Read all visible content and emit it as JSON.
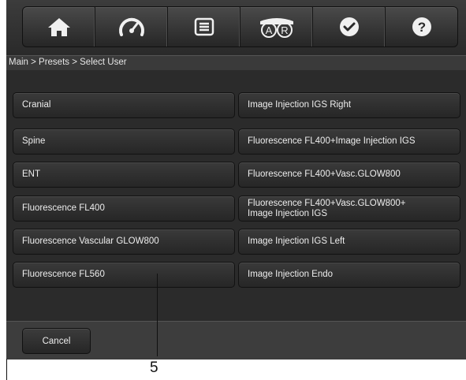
{
  "toolbar": {
    "icons": [
      "home-icon",
      "speedometer-icon",
      "menu-list-icon",
      "ar-eyepiece-icon",
      "checkmark-icon",
      "help-icon"
    ],
    "ar_labels": [
      "A",
      "R"
    ]
  },
  "breadcrumb": "Main > Presets > Select User",
  "presets": {
    "left": [
      "Cranial",
      "Spine",
      "ENT",
      "Fluorescence FL400",
      "Fluorescence Vascular GLOW800",
      "Fluorescence FL560"
    ],
    "right": [
      "Image Injection IGS Right",
      "Fluorescence FL400+Image Injection IGS",
      "Fluorescence FL400+Vasc.GLOW800",
      "Fluorescence FL400+Vasc.GLOW800+\nImage Injection IGS",
      "Image Injection IGS Left",
      "Image Injection Endo"
    ]
  },
  "footer": {
    "cancel_label": "Cancel"
  },
  "callout": {
    "number": "5"
  },
  "colors": {
    "background": "#2b2b2b",
    "button": "#303030",
    "text": "#ededed",
    "icon": "#f0f0f0"
  }
}
